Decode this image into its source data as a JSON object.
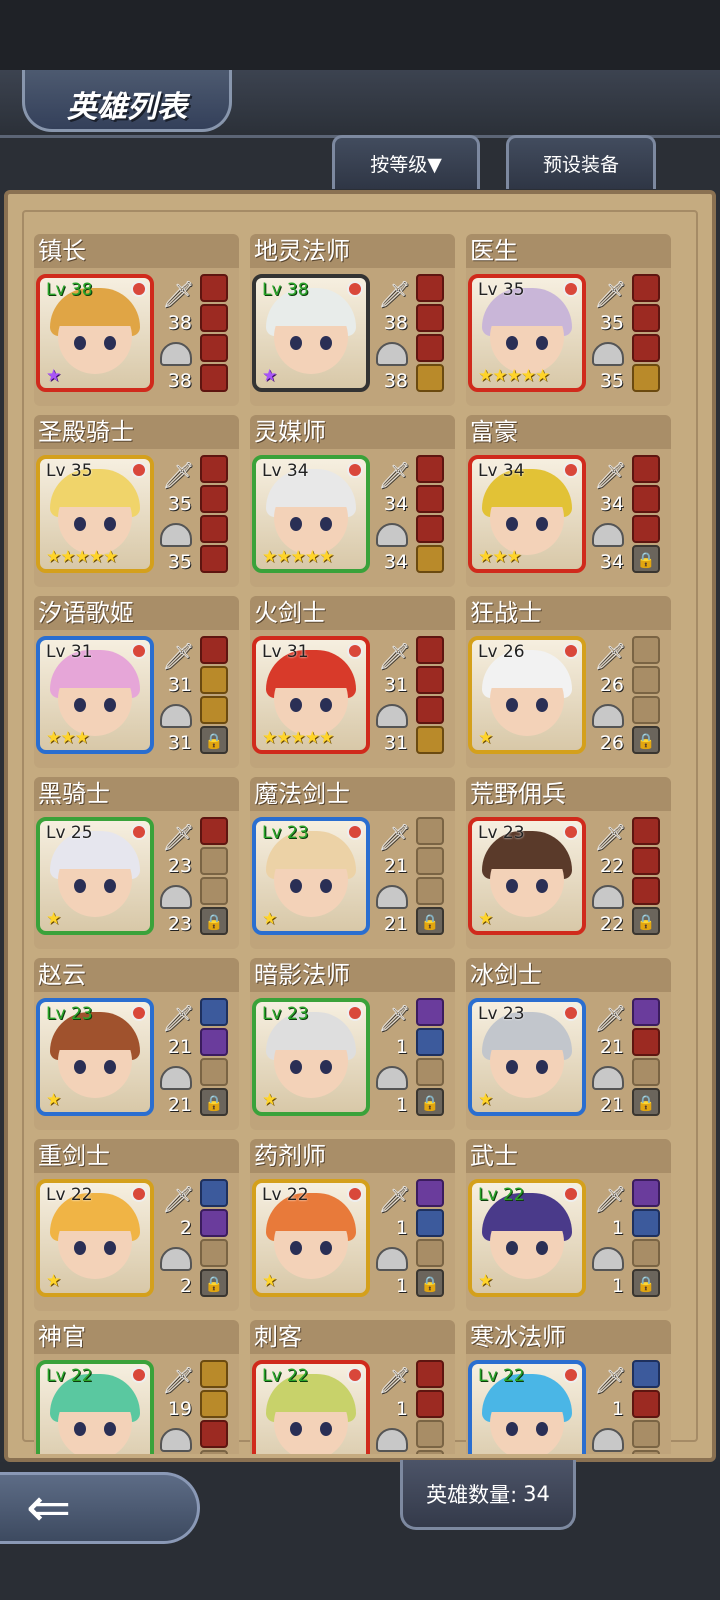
{
  "header": {
    "title": "英雄列表",
    "sort_label": "按等级▼",
    "preset_label": "预设装备"
  },
  "footer": {
    "count_label": "英雄数量:",
    "count_value": "34"
  },
  "heroes": [
    {
      "name": "镇长",
      "lv": "Lv 38",
      "lv_green": true,
      "stars": "★",
      "star_color": "purple",
      "atk": "38",
      "def": "38",
      "border": "#d02a1c",
      "hair": "#e0a545",
      "slots": [
        "red",
        "red",
        "red",
        "red"
      ]
    },
    {
      "name": "地灵法师",
      "lv": "Lv 38",
      "lv_green": true,
      "stars": "★",
      "star_color": "purple",
      "atk": "38",
      "def": "38",
      "border": "#333333",
      "hair": "#e8ecea",
      "slots": [
        "red",
        "red",
        "red",
        "gold"
      ]
    },
    {
      "name": "医生",
      "lv": "Lv 35",
      "lv_green": false,
      "stars": "★★★★★",
      "star_color": "gold",
      "atk": "35",
      "def": "35",
      "border": "#d02a1c",
      "hair": "#c9b6d8",
      "slots": [
        "red",
        "red",
        "red",
        "gold"
      ]
    },
    {
      "name": "圣殿骑士",
      "lv": "Lv 35",
      "lv_green": false,
      "stars": "★★★★★",
      "star_color": "gold",
      "atk": "35",
      "def": "35",
      "border": "#d4a01c",
      "hair": "#f0d46a",
      "slots": [
        "red",
        "red",
        "red",
        "red"
      ]
    },
    {
      "name": "灵媒师",
      "lv": "Lv 34",
      "lv_green": false,
      "stars": "★★★★★",
      "star_color": "gold",
      "atk": "34",
      "def": "34",
      "border": "#3aa23a",
      "hair": "#e8e8e8",
      "slots": [
        "red",
        "red",
        "red",
        "gold"
      ]
    },
    {
      "name": "富豪",
      "lv": "Lv 34",
      "lv_green": false,
      "stars": "★★★",
      "star_color": "gold",
      "atk": "34",
      "def": "34",
      "border": "#d02a1c",
      "hair": "#e2c236",
      "slots": [
        "red",
        "red",
        "red",
        "lock"
      ]
    },
    {
      "name": "汐语歌姬",
      "lv": "Lv 31",
      "lv_green": false,
      "stars": "★★★",
      "star_color": "gold",
      "atk": "31",
      "def": "31",
      "border": "#2a6ed0",
      "hair": "#e6a6d8",
      "slots": [
        "red",
        "gold",
        "gold",
        "lock"
      ]
    },
    {
      "name": "火剑士",
      "lv": "Lv 31",
      "lv_green": false,
      "stars": "★★★★★",
      "star_color": "gold",
      "atk": "31",
      "def": "31",
      "border": "#d02a1c",
      "hair": "#d83a2a",
      "slots": [
        "red",
        "red",
        "red",
        "gold"
      ]
    },
    {
      "name": "狂战士",
      "lv": "Lv 26",
      "lv_green": false,
      "stars": "★",
      "star_color": "gold",
      "atk": "26",
      "def": "26",
      "border": "#d4a01c",
      "hair": "#f2f2f2",
      "slots": [
        "empty",
        "empty",
        "empty",
        "lock"
      ]
    },
    {
      "name": "黑骑士",
      "lv": "Lv 25",
      "lv_green": false,
      "stars": "★",
      "star_color": "gold",
      "atk": "23",
      "def": "23",
      "border": "#3aa23a",
      "hair": "#e6e6ee",
      "slots": [
        "red",
        "empty",
        "empty",
        "lock"
      ]
    },
    {
      "name": "魔法剑士",
      "lv": "Lv 23",
      "lv_green": true,
      "stars": "★",
      "star_color": "gold",
      "atk": "21",
      "def": "21",
      "border": "#2a6ed0",
      "hair": "#ecd2a6",
      "slots": [
        "empty",
        "empty",
        "empty",
        "lock"
      ]
    },
    {
      "name": "荒野佣兵",
      "lv": "Lv 23",
      "lv_green": false,
      "stars": "★",
      "star_color": "gold",
      "atk": "22",
      "def": "22",
      "border": "#d02a1c",
      "hair": "#5a3a2a",
      "slots": [
        "red",
        "red",
        "red",
        "lock"
      ]
    },
    {
      "name": "赵云",
      "lv": "Lv 23",
      "lv_green": true,
      "stars": "★",
      "star_color": "gold",
      "atk": "21",
      "def": "21",
      "border": "#2a6ed0",
      "hair": "#a0522d",
      "slots": [
        "blue",
        "purple",
        "empty",
        "lock"
      ]
    },
    {
      "name": "暗影法师",
      "lv": "Lv 23",
      "lv_green": true,
      "stars": "★",
      "star_color": "gold",
      "atk": "1",
      "def": "1",
      "border": "#3aa23a",
      "hair": "#dedede",
      "slots": [
        "purple",
        "blue",
        "empty",
        "lock"
      ]
    },
    {
      "name": "冰剑士",
      "lv": "Lv 23",
      "lv_green": false,
      "stars": "★",
      "star_color": "gold",
      "atk": "21",
      "def": "21",
      "border": "#2a6ed0",
      "hair": "#c2c6cc",
      "slots": [
        "purple",
        "red",
        "empty",
        "lock"
      ]
    },
    {
      "name": "重剑士",
      "lv": "Lv 22",
      "lv_green": false,
      "stars": "★",
      "star_color": "gold",
      "atk": "2",
      "def": "2",
      "border": "#d4a01c",
      "hair": "#f0b445",
      "slots": [
        "blue",
        "purple",
        "empty",
        "lock"
      ]
    },
    {
      "name": "药剂师",
      "lv": "Lv 22",
      "lv_green": false,
      "stars": "★",
      "star_color": "gold",
      "atk": "1",
      "def": "1",
      "border": "#d4a01c",
      "hair": "#e87a3a",
      "slots": [
        "purple",
        "blue",
        "empty",
        "lock"
      ]
    },
    {
      "name": "武士",
      "lv": "Lv 22",
      "lv_green": true,
      "stars": "★",
      "star_color": "gold",
      "atk": "1",
      "def": "1",
      "border": "#d4a01c",
      "hair": "#4a3a8a",
      "slots": [
        "purple",
        "blue",
        "empty",
        "lock"
      ]
    },
    {
      "name": "神官",
      "lv": "Lv 22",
      "lv_green": true,
      "stars": "",
      "star_color": "gold",
      "atk": "19",
      "def": "",
      "border": "#3aa23a",
      "hair": "#5ac8a0",
      "slots": [
        "gold",
        "gold",
        "red",
        "empty"
      ]
    },
    {
      "name": "刺客",
      "lv": "Lv 22",
      "lv_green": true,
      "stars": "",
      "star_color": "gold",
      "atk": "1",
      "def": "",
      "border": "#d02a1c",
      "hair": "#c8d26a",
      "slots": [
        "red",
        "red",
        "empty",
        "empty"
      ]
    },
    {
      "name": "寒冰法师",
      "lv": "Lv 22",
      "lv_green": true,
      "stars": "",
      "star_color": "gold",
      "atk": "1",
      "def": "",
      "border": "#2a6ed0",
      "hair": "#4ab6e6",
      "slots": [
        "blue",
        "red",
        "empty",
        "empty"
      ]
    }
  ]
}
